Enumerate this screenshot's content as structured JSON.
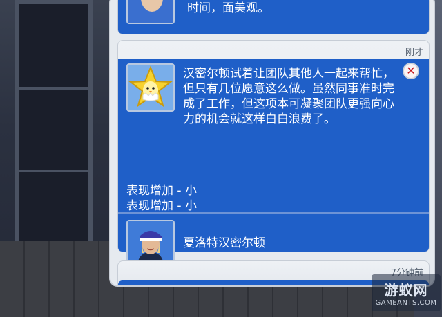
{
  "top_card": {
    "text": "时间，面美观。"
  },
  "main_card": {
    "timestamp": "刚才",
    "body": "汉密尔顿试着让团队其他人一起来帮忙，但只有几位愿意这么做。虽然同事准时完成了工作，但这项本可凝聚团队更强向心力的机会就这样白白浪费了。",
    "effects": [
      "表现增加 - 小",
      "表现增加 - 小"
    ],
    "sim_name": "夏洛特汉密尔顿",
    "icons": {
      "star": "star-chick-icon",
      "close": "close-icon"
    },
    "colors": {
      "blue": "#1f5fc8",
      "close": "#c4171e"
    }
  },
  "bottom_card": {
    "timestamp": "7分钟前"
  },
  "watermark": {
    "cn": "游蚁网",
    "en": "GAMEANTS.COM"
  }
}
